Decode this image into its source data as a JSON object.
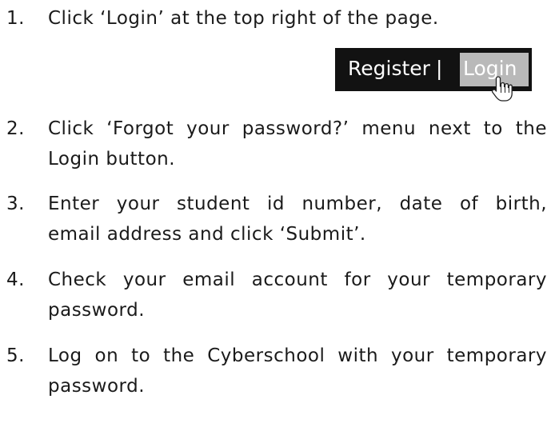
{
  "steps": [
    {
      "number": "1.",
      "lines": [
        "Click ‘Login’ at the top right of the page."
      ]
    },
    {
      "number": "2.",
      "lines": [
        "Click ‘Forgot your password?’ menu next to the",
        "Login button."
      ]
    },
    {
      "number": "3.",
      "lines": [
        "Enter your student id number, date of birth,",
        "email address and click ‘Submit’."
      ]
    },
    {
      "number": "4.",
      "lines": [
        "Check your email account for your temporary",
        "password."
      ]
    },
    {
      "number": "5.",
      "lines": [
        "Log on to the Cyberschool with your temporary",
        "password."
      ]
    }
  ],
  "login_bar": {
    "register_label": "Register",
    "separator": "|",
    "login_label": "Login",
    "cursor_icon": "hand-pointer-icon",
    "background_color": "#121212",
    "login_highlight_color": "#b9b9b9"
  }
}
